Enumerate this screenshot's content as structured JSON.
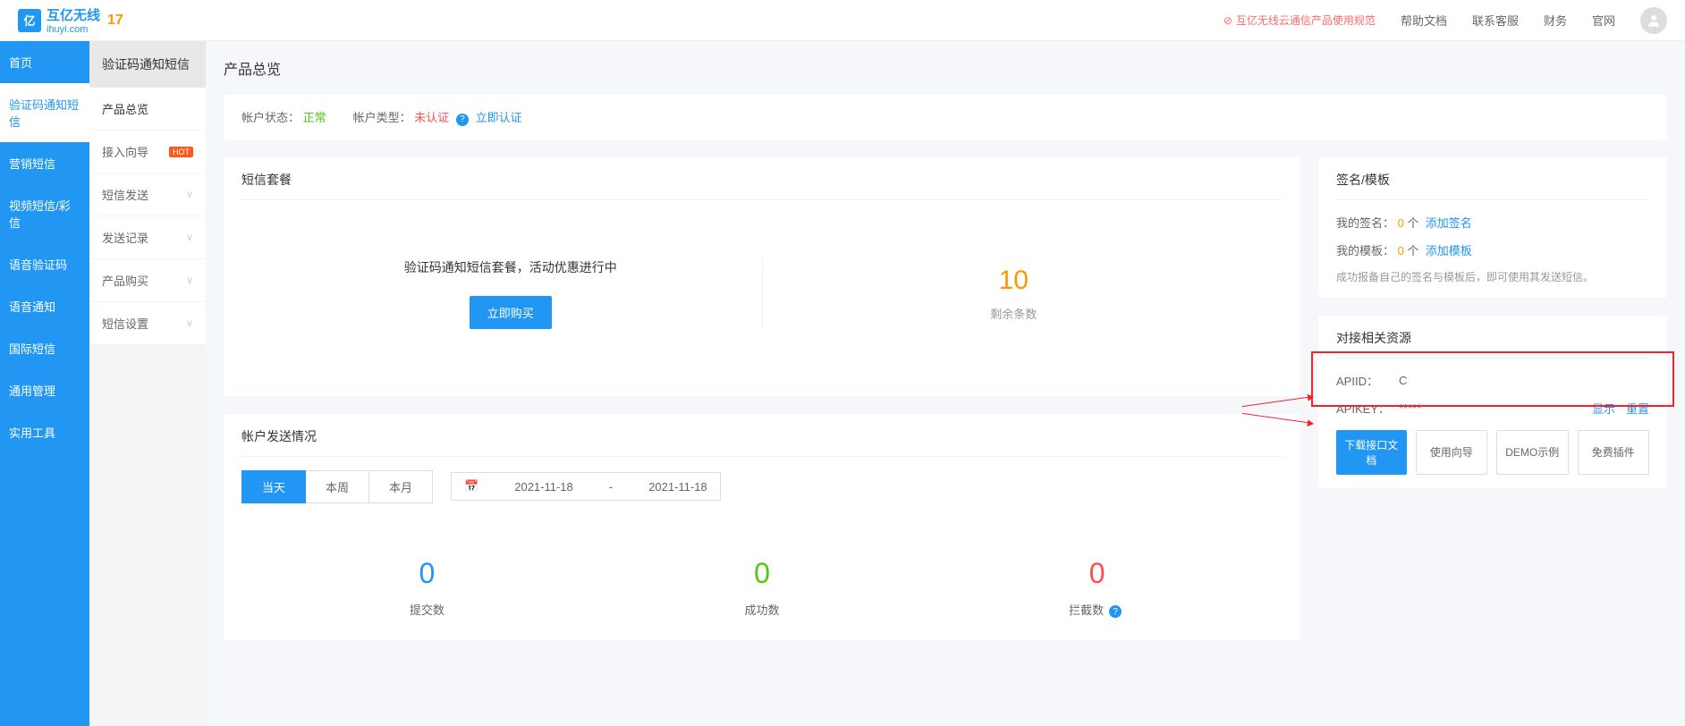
{
  "header": {
    "logo_text": "互亿无线",
    "logo_sub": "ihuyi.com",
    "logo_badge": "17",
    "notice": "互亿无线云通信产品使用规范",
    "links": [
      "帮助文档",
      "联系客服",
      "财务",
      "官网"
    ]
  },
  "sidebar_main": [
    "首页",
    "验证码通知短信",
    "营销短信",
    "视频短信/彩信",
    "语音验证码",
    "语音通知",
    "国际短信",
    "通用管理",
    "实用工具"
  ],
  "sidebar_main_active": 1,
  "sidebar_sub": {
    "title": "验证码通知短信",
    "items": [
      {
        "label": "产品总览",
        "active": true
      },
      {
        "label": "接入向导",
        "hot": true
      },
      {
        "label": "短信发送",
        "chevron": true
      },
      {
        "label": "发送记录",
        "chevron": true
      },
      {
        "label": "产品购买",
        "chevron": true
      },
      {
        "label": "短信设置",
        "chevron": true
      }
    ]
  },
  "page_title": "产品总览",
  "status": {
    "status_label": "帐户状态：",
    "status_value": "正常",
    "type_label": "帐户类型：",
    "type_value": "未认证",
    "auth_link": "立即认证"
  },
  "package": {
    "title": "短信套餐",
    "text": "验证码通知短信套餐，活动优惠进行中",
    "buy_btn": "立即购买",
    "remaining_num": "10",
    "remaining_label": "剩余条数"
  },
  "sign": {
    "title": "签名/模板",
    "sign_label": "我的签名：",
    "sign_count": "0",
    "sign_unit": "个",
    "sign_link": "添加签名",
    "tpl_label": "我的模板：",
    "tpl_count": "0",
    "tpl_unit": "个",
    "tpl_link": "添加模板",
    "tip": "成功报备自己的签名与模板后，即可使用其发送短信。"
  },
  "api": {
    "title": "对接相关资源",
    "apiid_label": "APIID：",
    "apiid_value": "C",
    "apikey_label": "APIKEY：",
    "apikey_value": "*****",
    "show_link": "显示",
    "reset_link": "重置",
    "buttons": [
      "下载接口文档",
      "使用向导",
      "DEMO示例",
      "免费插件"
    ]
  },
  "sending": {
    "title": "帐户发送情况",
    "tabs": [
      "当天",
      "本周",
      "本月"
    ],
    "active_tab": 0,
    "date_from": "2021-11-18",
    "date_sep": "-",
    "date_to": "2021-11-18",
    "stats": [
      {
        "num": "0",
        "label": "提交数",
        "cls": "blue"
      },
      {
        "num": "0",
        "label": "成功数",
        "cls": "green"
      },
      {
        "num": "0",
        "label": "拦截数",
        "cls": "red",
        "help": true
      }
    ]
  }
}
